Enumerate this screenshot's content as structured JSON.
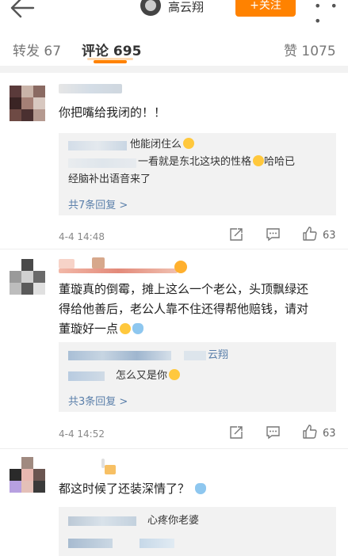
{
  "header": {
    "user_name": "高云翔",
    "follow_label": "+关注",
    "more_label": "• • •"
  },
  "tabs": [
    {
      "label": "转发 67"
    },
    {
      "label": "评论 695"
    },
    {
      "label": "赞 1075"
    }
  ],
  "comments": [
    {
      "text": "你把嘴给我闭的！！",
      "replies": [
        {
          "text": "他能闭住么"
        },
        {
          "text": "一看就是东北这块的性格"
        },
        {
          "text": "哈哈已"
        },
        {
          "text": "经脑补出语音来了"
        }
      ],
      "more_replies": "共7条回复 >",
      "date": "4-4 14:48",
      "likes": "63"
    },
    {
      "text_lines": [
        "董璇真的倒霉，摊上这么一个老公，头顶飘绿还",
        "得给他善后，老公人靠不住还得帮他赔钱，请对",
        "董璇好一点"
      ],
      "replies": [
        {
          "text": "云翔"
        },
        {
          "text": "怎么又是你"
        }
      ],
      "more_replies": "共3条回复 >",
      "date": "4-4 14:52",
      "likes": "63"
    },
    {
      "text": "都这时候了还装深情了？",
      "replies": [
        {
          "text": "心疼你老婆"
        }
      ]
    }
  ],
  "colors": {
    "accent": "#ff8200",
    "link": "#5a7faa",
    "separator": "#f2f2f2"
  }
}
